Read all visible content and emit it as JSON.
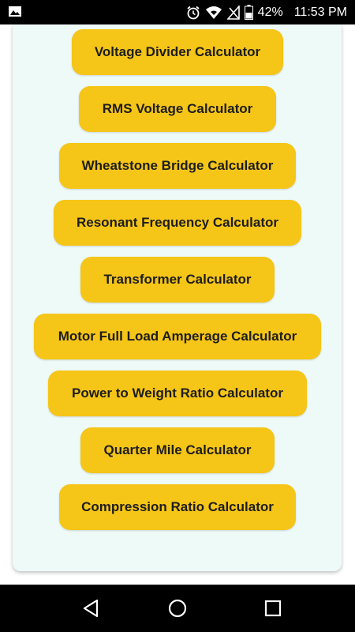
{
  "status_bar": {
    "battery_percent": "42%",
    "time": "11:53 PM",
    "icons": [
      "image-notification-icon",
      "alarm-icon",
      "wifi-icon",
      "no-sim-icon",
      "battery-icon"
    ]
  },
  "calculators": [
    {
      "label": "Voltage Divider Calculator"
    },
    {
      "label": "RMS Voltage Calculator"
    },
    {
      "label": "Wheatstone Bridge Calculator"
    },
    {
      "label": "Resonant Frequency Calculator"
    },
    {
      "label": "Transformer Calculator"
    },
    {
      "label": "Motor Full Load Amperage Calculator"
    },
    {
      "label": "Power to Weight Ratio Calculator"
    },
    {
      "label": "Quarter Mile Calculator"
    },
    {
      "label": "Compression Ratio Calculator"
    }
  ],
  "nav_bar": {
    "icons": [
      "back-icon",
      "home-icon",
      "recents-icon"
    ]
  },
  "colors": {
    "button": "#f5c518",
    "card_background": "#eefaf8",
    "button_text": "#1d1d1d",
    "bar_background": "#000000"
  }
}
